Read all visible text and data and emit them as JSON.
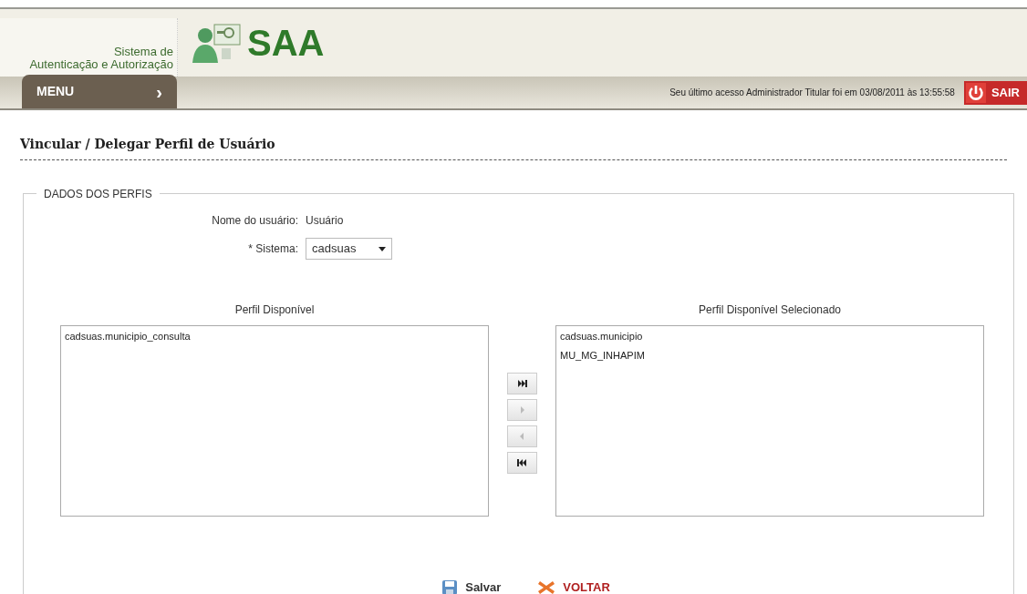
{
  "header": {
    "system_name_line1": "Sistema de",
    "system_name_line2": "Autenticação e Autorização",
    "logo_text": "SAA"
  },
  "nav": {
    "menu_label": "MENU",
    "menu_arrow": "›",
    "last_access": "Seu último acesso Administrador Titular foi em 03/08/2011 às 13:55:58",
    "logout_label": "SAIR"
  },
  "page_title": "Vincular / Delegar Perfil de Usuário",
  "fieldset": {
    "legend": "DADOS DOS PERFIS",
    "user_label": "Nome do usuário:",
    "user_value": "Usuário",
    "system_label": "* Sistema:",
    "system_value": "cadsuas",
    "available": {
      "title": "Perfil Disponível",
      "items": [
        "cadsuas.municipio_consulta"
      ]
    },
    "selected": {
      "title": "Perfil Disponível Selecionado",
      "items": [
        "cadsuas.municipio",
        "MU_MG_INHAPIM"
      ]
    },
    "move_buttons": [
      {
        "kind": "all_right",
        "disabled": false
      },
      {
        "kind": "right",
        "disabled": true
      },
      {
        "kind": "left",
        "disabled": true
      },
      {
        "kind": "all_left",
        "disabled": false
      }
    ]
  },
  "actions": {
    "save": "Salvar",
    "back": "VOLTAR"
  }
}
